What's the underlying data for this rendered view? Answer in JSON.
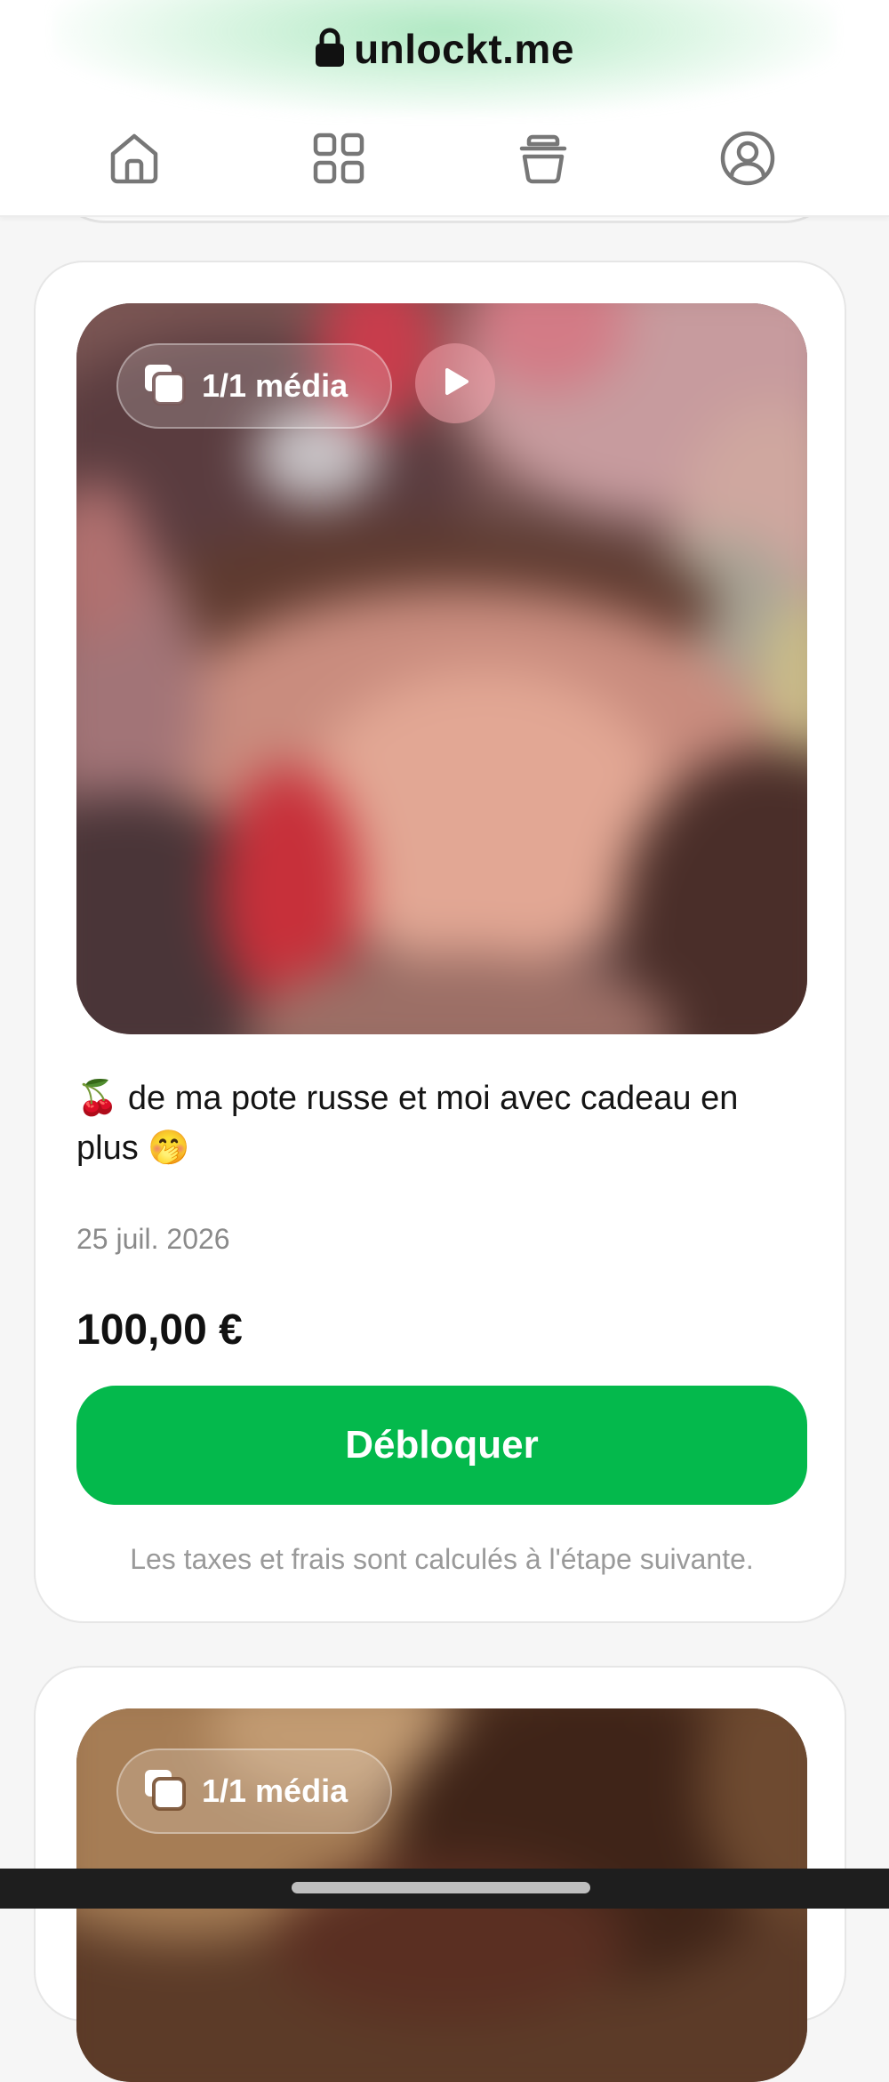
{
  "header": {
    "brand": "unlockt.me",
    "nav": [
      {
        "name": "home"
      },
      {
        "name": "grid"
      },
      {
        "name": "cup"
      },
      {
        "name": "profile"
      }
    ]
  },
  "posts": [
    {
      "media_count_label": "1/1 média",
      "has_video": true,
      "caption": "🍒 de ma pote russe et moi avec cadeau en plus 🤭",
      "date": "25 juil. 2026",
      "price": "100,00 €",
      "unlock_label": "Débloquer",
      "tax_note": "Les taxes et frais sont calculés à l'étape suivante."
    },
    {
      "media_count_label": "1/1 média"
    }
  ],
  "colors": {
    "accent_green": "#04b94c",
    "muted_text": "#8a8a8a"
  }
}
